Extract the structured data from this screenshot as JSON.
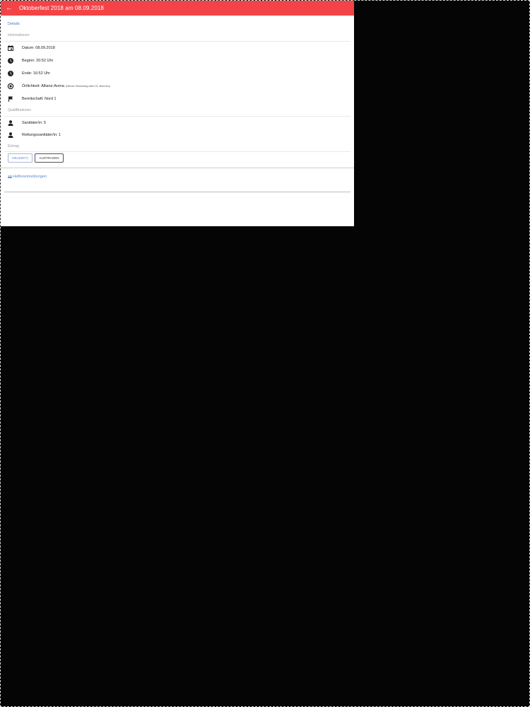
{
  "appbar": {
    "title": "Oktoberfest 2018 am 08.09.2018",
    "back_icon": "arrow-back-icon",
    "color": "#f44346"
  },
  "tabs": {
    "details": "Details"
  },
  "sections": {
    "informationen": "Informationen",
    "qualifikationen": "Qualifikationen",
    "eintrag": "Eintrag"
  },
  "info": [
    {
      "icon": "calendar-icon",
      "text": "Datum: 08.09.2018"
    },
    {
      "icon": "clock-icon",
      "text": "Beginn: 20:52 Uhr"
    },
    {
      "icon": "clock-icon",
      "text": "Ende: 16:52 Uhr"
    },
    {
      "icon": "location-icon",
      "text": "Örtlichkeit: Allianz-Arena",
      "sub": "(Werner-Heisenberg-Allee 25, München)"
    },
    {
      "icon": "flag-icon",
      "text": "Bereitschaft: Nord 1"
    }
  ],
  "qualifications": [
    {
      "icon": "person-icon",
      "text": "Sanitäter/in: 5"
    },
    {
      "icon": "person-icon",
      "text": "Rettungssanitäter/in: 1"
    }
  ],
  "actions": {
    "neu": "NEU(SEIT)",
    "austragen": "AUSTRAGEN"
  },
  "links": {
    "helferliste": "Helferanmeldungen",
    "helferliste_icon": "group-icon"
  },
  "colors": {
    "accent": "#5c86d0",
    "divider": "#e9e9e9"
  }
}
